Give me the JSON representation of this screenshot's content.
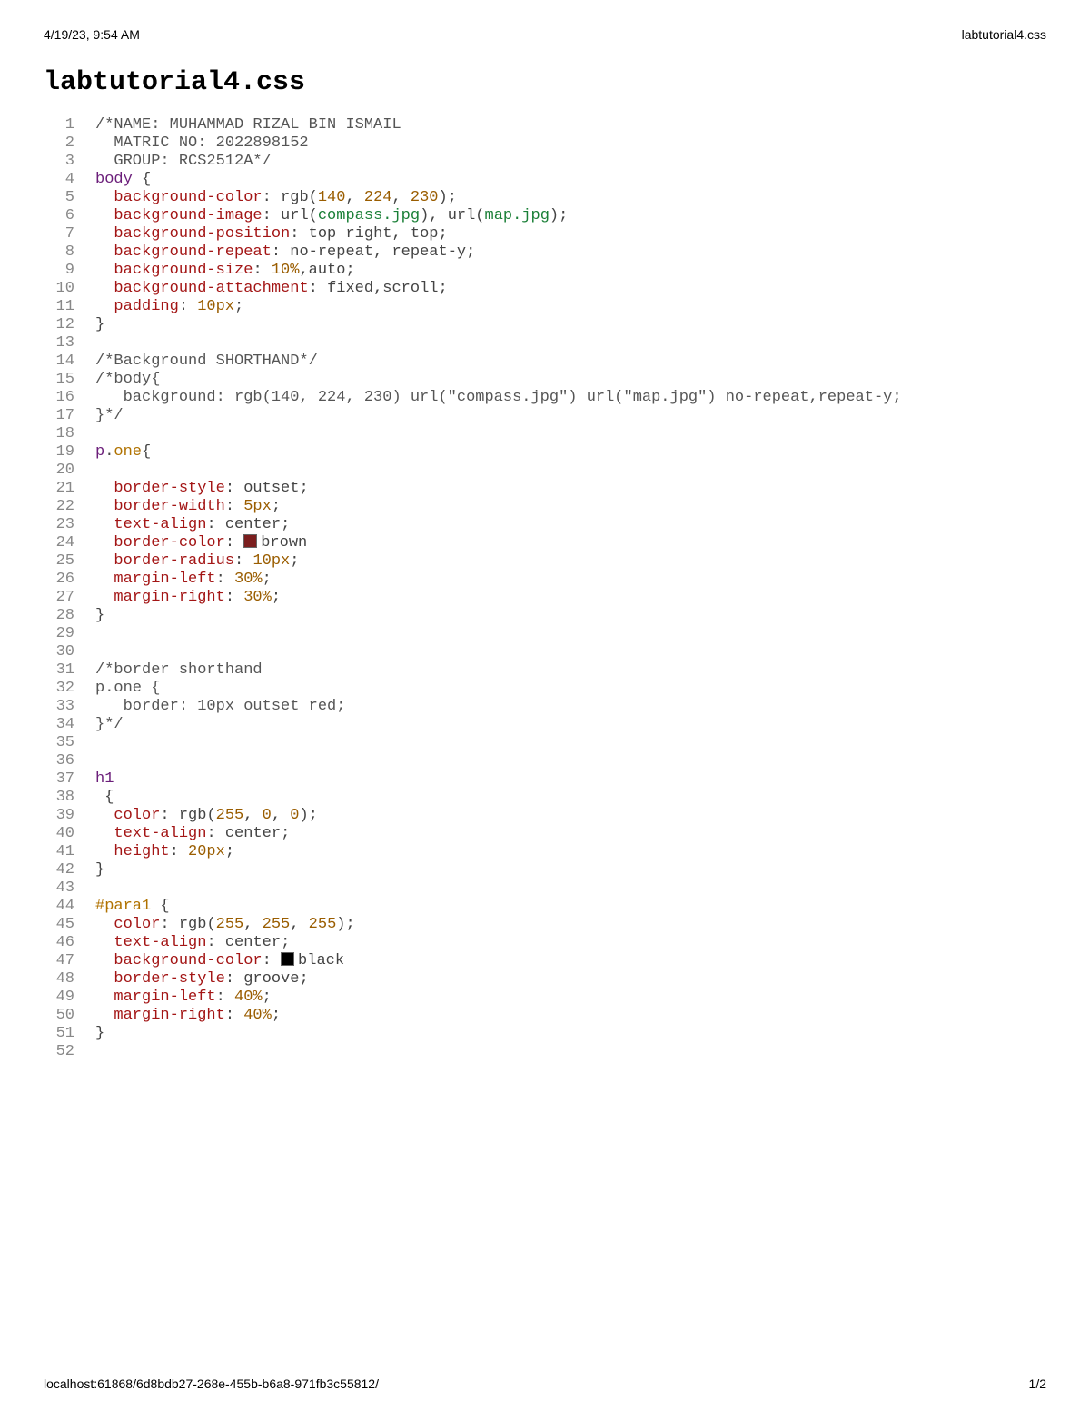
{
  "header": {
    "timestamp": "4/19/23, 9:54 AM",
    "filename": "labtutorial4.css"
  },
  "title": "labtutorial4.css",
  "footer": {
    "url": "localhost:61868/6d8bdb27-268e-455b-b6a8-971fb3c55812/",
    "page": "1/2"
  },
  "colors": {
    "brown": "#7b1e1e",
    "black": "#000000"
  },
  "code": {
    "total_lines": 52,
    "lines": [
      {
        "n": 1,
        "tokens": [
          [
            "comment",
            "/*NAME: MUHAMMAD RIZAL BIN ISMAIL"
          ]
        ]
      },
      {
        "n": 2,
        "tokens": [
          [
            "comment",
            "  MATRIC NO: 2022898152"
          ]
        ]
      },
      {
        "n": 3,
        "tokens": [
          [
            "comment",
            "  GROUP: RCS2512A*/"
          ]
        ]
      },
      {
        "n": 4,
        "tokens": [
          [
            "sel",
            "body"
          ],
          [
            "punc",
            " {"
          ]
        ]
      },
      {
        "n": 5,
        "tokens": [
          [
            "plain",
            "  "
          ],
          [
            "prop",
            "background-color"
          ],
          [
            "punc",
            ": "
          ],
          [
            "func",
            "rgb"
          ],
          [
            "punc",
            "("
          ],
          [
            "num",
            "140"
          ],
          [
            "punc",
            ", "
          ],
          [
            "num",
            "224"
          ],
          [
            "punc",
            ", "
          ],
          [
            "num",
            "230"
          ],
          [
            "punc",
            ");"
          ]
        ]
      },
      {
        "n": 6,
        "tokens": [
          [
            "plain",
            "  "
          ],
          [
            "prop",
            "background-image"
          ],
          [
            "punc",
            ": "
          ],
          [
            "func",
            "url"
          ],
          [
            "punc",
            "("
          ],
          [
            "str",
            "compass.jpg"
          ],
          [
            "punc",
            "), "
          ],
          [
            "func",
            "url"
          ],
          [
            "punc",
            "("
          ],
          [
            "str",
            "map.jpg"
          ],
          [
            "punc",
            ");"
          ]
        ]
      },
      {
        "n": 7,
        "tokens": [
          [
            "plain",
            "  "
          ],
          [
            "prop",
            "background-position"
          ],
          [
            "punc",
            ": "
          ],
          [
            "val",
            "top right"
          ],
          [
            "punc",
            ", "
          ],
          [
            "val",
            "top"
          ],
          [
            "punc",
            ";"
          ]
        ]
      },
      {
        "n": 8,
        "tokens": [
          [
            "plain",
            "  "
          ],
          [
            "prop",
            "background-repeat"
          ],
          [
            "punc",
            ": "
          ],
          [
            "val",
            "no-repeat"
          ],
          [
            "punc",
            ", "
          ],
          [
            "val",
            "repeat-y"
          ],
          [
            "punc",
            ";"
          ]
        ]
      },
      {
        "n": 9,
        "tokens": [
          [
            "plain",
            "  "
          ],
          [
            "prop",
            "background-size"
          ],
          [
            "punc",
            ": "
          ],
          [
            "num",
            "10%"
          ],
          [
            "punc",
            ","
          ],
          [
            "val",
            "auto"
          ],
          [
            "punc",
            ";"
          ]
        ]
      },
      {
        "n": 10,
        "tokens": [
          [
            "plain",
            "  "
          ],
          [
            "prop",
            "background-attachment"
          ],
          [
            "punc",
            ": "
          ],
          [
            "val",
            "fixed"
          ],
          [
            "punc",
            ","
          ],
          [
            "val",
            "scroll"
          ],
          [
            "punc",
            ";"
          ]
        ]
      },
      {
        "n": 11,
        "tokens": [
          [
            "plain",
            "  "
          ],
          [
            "prop",
            "padding"
          ],
          [
            "punc",
            ": "
          ],
          [
            "num",
            "10px"
          ],
          [
            "punc",
            ";"
          ]
        ]
      },
      {
        "n": 12,
        "tokens": [
          [
            "punc",
            "}"
          ]
        ]
      },
      {
        "n": 13,
        "tokens": [
          [
            "plain",
            ""
          ]
        ]
      },
      {
        "n": 14,
        "tokens": [
          [
            "comment",
            "/*Background SHORTHAND*/"
          ]
        ]
      },
      {
        "n": 15,
        "tokens": [
          [
            "comment",
            "/*body{"
          ]
        ]
      },
      {
        "n": 16,
        "tokens": [
          [
            "comment",
            "   background: rgb(140, 224, 230) url(\"compass.jpg\") url(\"map.jpg\") no-repeat,repeat-y;"
          ]
        ]
      },
      {
        "n": 17,
        "tokens": [
          [
            "comment",
            "}*/"
          ]
        ]
      },
      {
        "n": 18,
        "tokens": [
          [
            "plain",
            ""
          ]
        ]
      },
      {
        "n": 19,
        "tokens": [
          [
            "sel",
            "p"
          ],
          [
            "punc",
            "."
          ],
          [
            "class",
            "one"
          ],
          [
            "punc",
            "{"
          ]
        ]
      },
      {
        "n": 20,
        "tokens": [
          [
            "plain",
            ""
          ]
        ]
      },
      {
        "n": 21,
        "tokens": [
          [
            "plain",
            "  "
          ],
          [
            "prop",
            "border-style"
          ],
          [
            "punc",
            ": "
          ],
          [
            "val",
            "outset"
          ],
          [
            "punc",
            ";"
          ]
        ]
      },
      {
        "n": 22,
        "tokens": [
          [
            "plain",
            "  "
          ],
          [
            "prop",
            "border-width"
          ],
          [
            "punc",
            ": "
          ],
          [
            "num",
            "5px"
          ],
          [
            "punc",
            ";"
          ]
        ]
      },
      {
        "n": 23,
        "tokens": [
          [
            "plain",
            "  "
          ],
          [
            "prop",
            "text-align"
          ],
          [
            "punc",
            ": "
          ],
          [
            "val",
            "center"
          ],
          [
            "punc",
            ";"
          ]
        ]
      },
      {
        "n": 24,
        "tokens": [
          [
            "plain",
            "  "
          ],
          [
            "prop",
            "border-color"
          ],
          [
            "punc",
            ": "
          ],
          [
            "swatch",
            "brown"
          ],
          [
            "val",
            "brown"
          ]
        ]
      },
      {
        "n": 25,
        "tokens": [
          [
            "plain",
            "  "
          ],
          [
            "prop",
            "border-radius"
          ],
          [
            "punc",
            ": "
          ],
          [
            "num",
            "10px"
          ],
          [
            "punc",
            ";"
          ]
        ]
      },
      {
        "n": 26,
        "tokens": [
          [
            "plain",
            "  "
          ],
          [
            "prop",
            "margin-left"
          ],
          [
            "punc",
            ": "
          ],
          [
            "num",
            "30%"
          ],
          [
            "punc",
            ";"
          ]
        ]
      },
      {
        "n": 27,
        "tokens": [
          [
            "plain",
            "  "
          ],
          [
            "prop",
            "margin-right"
          ],
          [
            "punc",
            ": "
          ],
          [
            "num",
            "30%"
          ],
          [
            "punc",
            ";"
          ]
        ]
      },
      {
        "n": 28,
        "tokens": [
          [
            "punc",
            "}"
          ]
        ]
      },
      {
        "n": 29,
        "tokens": [
          [
            "plain",
            ""
          ]
        ]
      },
      {
        "n": 30,
        "tokens": [
          [
            "plain",
            ""
          ]
        ]
      },
      {
        "n": 31,
        "tokens": [
          [
            "comment",
            "/*border shorthand"
          ]
        ]
      },
      {
        "n": 32,
        "tokens": [
          [
            "comment",
            "p.one {"
          ]
        ]
      },
      {
        "n": 33,
        "tokens": [
          [
            "comment",
            "   border: 10px outset red;"
          ]
        ]
      },
      {
        "n": 34,
        "tokens": [
          [
            "comment",
            "}*/"
          ]
        ]
      },
      {
        "n": 35,
        "tokens": [
          [
            "plain",
            ""
          ]
        ]
      },
      {
        "n": 36,
        "tokens": [
          [
            "plain",
            ""
          ]
        ]
      },
      {
        "n": 37,
        "tokens": [
          [
            "sel",
            "h1"
          ]
        ]
      },
      {
        "n": 38,
        "tokens": [
          [
            "punc",
            " {"
          ]
        ]
      },
      {
        "n": 39,
        "tokens": [
          [
            "plain",
            "  "
          ],
          [
            "prop",
            "color"
          ],
          [
            "punc",
            ": "
          ],
          [
            "func",
            "rgb"
          ],
          [
            "punc",
            "("
          ],
          [
            "num",
            "255"
          ],
          [
            "punc",
            ", "
          ],
          [
            "num",
            "0"
          ],
          [
            "punc",
            ", "
          ],
          [
            "num",
            "0"
          ],
          [
            "punc",
            ");"
          ]
        ]
      },
      {
        "n": 40,
        "tokens": [
          [
            "plain",
            "  "
          ],
          [
            "prop",
            "text-align"
          ],
          [
            "punc",
            ": "
          ],
          [
            "val",
            "center"
          ],
          [
            "punc",
            ";"
          ]
        ]
      },
      {
        "n": 41,
        "tokens": [
          [
            "plain",
            "  "
          ],
          [
            "prop",
            "height"
          ],
          [
            "punc",
            ": "
          ],
          [
            "num",
            "20px"
          ],
          [
            "punc",
            ";"
          ]
        ]
      },
      {
        "n": 42,
        "tokens": [
          [
            "punc",
            "}"
          ]
        ]
      },
      {
        "n": 43,
        "tokens": [
          [
            "plain",
            ""
          ]
        ]
      },
      {
        "n": 44,
        "tokens": [
          [
            "id",
            "#para1"
          ],
          [
            "punc",
            " {"
          ]
        ]
      },
      {
        "n": 45,
        "tokens": [
          [
            "plain",
            "  "
          ],
          [
            "prop",
            "color"
          ],
          [
            "punc",
            ": "
          ],
          [
            "func",
            "rgb"
          ],
          [
            "punc",
            "("
          ],
          [
            "num",
            "255"
          ],
          [
            "punc",
            ", "
          ],
          [
            "num",
            "255"
          ],
          [
            "punc",
            ", "
          ],
          [
            "num",
            "255"
          ],
          [
            "punc",
            ");"
          ]
        ]
      },
      {
        "n": 46,
        "tokens": [
          [
            "plain",
            "  "
          ],
          [
            "prop",
            "text-align"
          ],
          [
            "punc",
            ": "
          ],
          [
            "val",
            "center"
          ],
          [
            "punc",
            ";"
          ]
        ]
      },
      {
        "n": 47,
        "tokens": [
          [
            "plain",
            "  "
          ],
          [
            "prop",
            "background-color"
          ],
          [
            "punc",
            ": "
          ],
          [
            "swatch",
            "black"
          ],
          [
            "val",
            "black"
          ]
        ]
      },
      {
        "n": 48,
        "tokens": [
          [
            "plain",
            "  "
          ],
          [
            "prop",
            "border-style"
          ],
          [
            "punc",
            ": "
          ],
          [
            "val",
            "groove"
          ],
          [
            "punc",
            ";"
          ]
        ]
      },
      {
        "n": 49,
        "tokens": [
          [
            "plain",
            "  "
          ],
          [
            "prop",
            "margin-left"
          ],
          [
            "punc",
            ": "
          ],
          [
            "num",
            "40%"
          ],
          [
            "punc",
            ";"
          ]
        ]
      },
      {
        "n": 50,
        "tokens": [
          [
            "plain",
            "  "
          ],
          [
            "prop",
            "margin-right"
          ],
          [
            "punc",
            ": "
          ],
          [
            "num",
            "40%"
          ],
          [
            "punc",
            ";"
          ]
        ]
      },
      {
        "n": 51,
        "tokens": [
          [
            "punc",
            "}"
          ]
        ]
      },
      {
        "n": 52,
        "tokens": [
          [
            "plain",
            ""
          ]
        ]
      }
    ]
  }
}
